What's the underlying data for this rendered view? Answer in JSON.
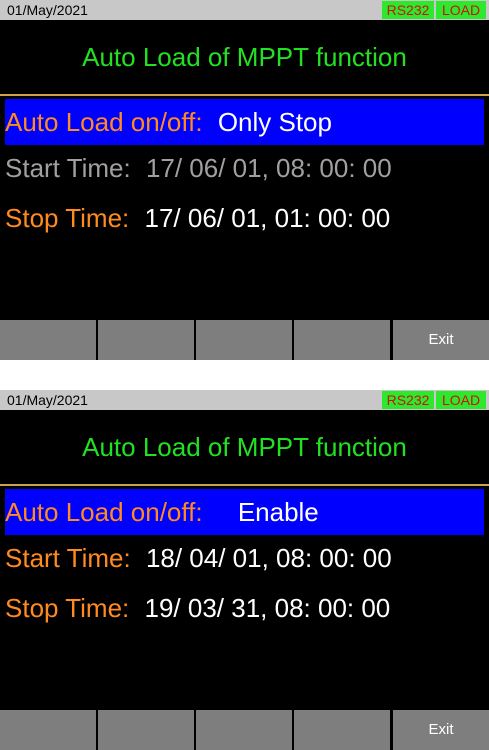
{
  "screens": [
    {
      "status": {
        "date": "01/May/2021",
        "badges": [
          "RS232",
          "LOAD"
        ]
      },
      "title": "Auto Load of MPPT function",
      "rows": [
        {
          "label": "Auto Load on/off:",
          "value": "Only Stop",
          "state": "selected"
        },
        {
          "label": "Start Time:",
          "value": "17/ 06/ 01, 08: 00: 00",
          "state": "disabled"
        },
        {
          "label": "Stop Time:",
          "value": "17/ 06/ 01, 01: 00: 00",
          "state": "normal"
        }
      ],
      "softkeys": [
        "",
        "",
        "",
        "",
        "Exit"
      ]
    },
    {
      "status": {
        "date": "01/May/2021",
        "badges": [
          "RS232",
          "LOAD"
        ]
      },
      "title": "Auto Load of MPPT function",
      "rows": [
        {
          "label": "Auto Load on/off:",
          "value": "Enable",
          "state": "selected"
        },
        {
          "label": "Start Time:",
          "value": "18/ 04/ 01, 08: 00: 00",
          "state": "normal"
        },
        {
          "label": "Stop Time:",
          "value": "19/ 03/ 31, 08: 00: 00",
          "state": "normal"
        }
      ],
      "softkeys": [
        "",
        "",
        "",
        "",
        "Exit"
      ]
    }
  ],
  "colors": {
    "title_text": "#22e022",
    "label_text": "#ff8a1e",
    "value_text": "#ffffff",
    "disabled_text": "#a0a0a0",
    "selected_bg": "#0000ff",
    "status_bg": "#c8c8c8",
    "badge_bg": "#2ee82e",
    "badge_text": "#d01010",
    "softkey_bg": "#7e7e7e"
  }
}
